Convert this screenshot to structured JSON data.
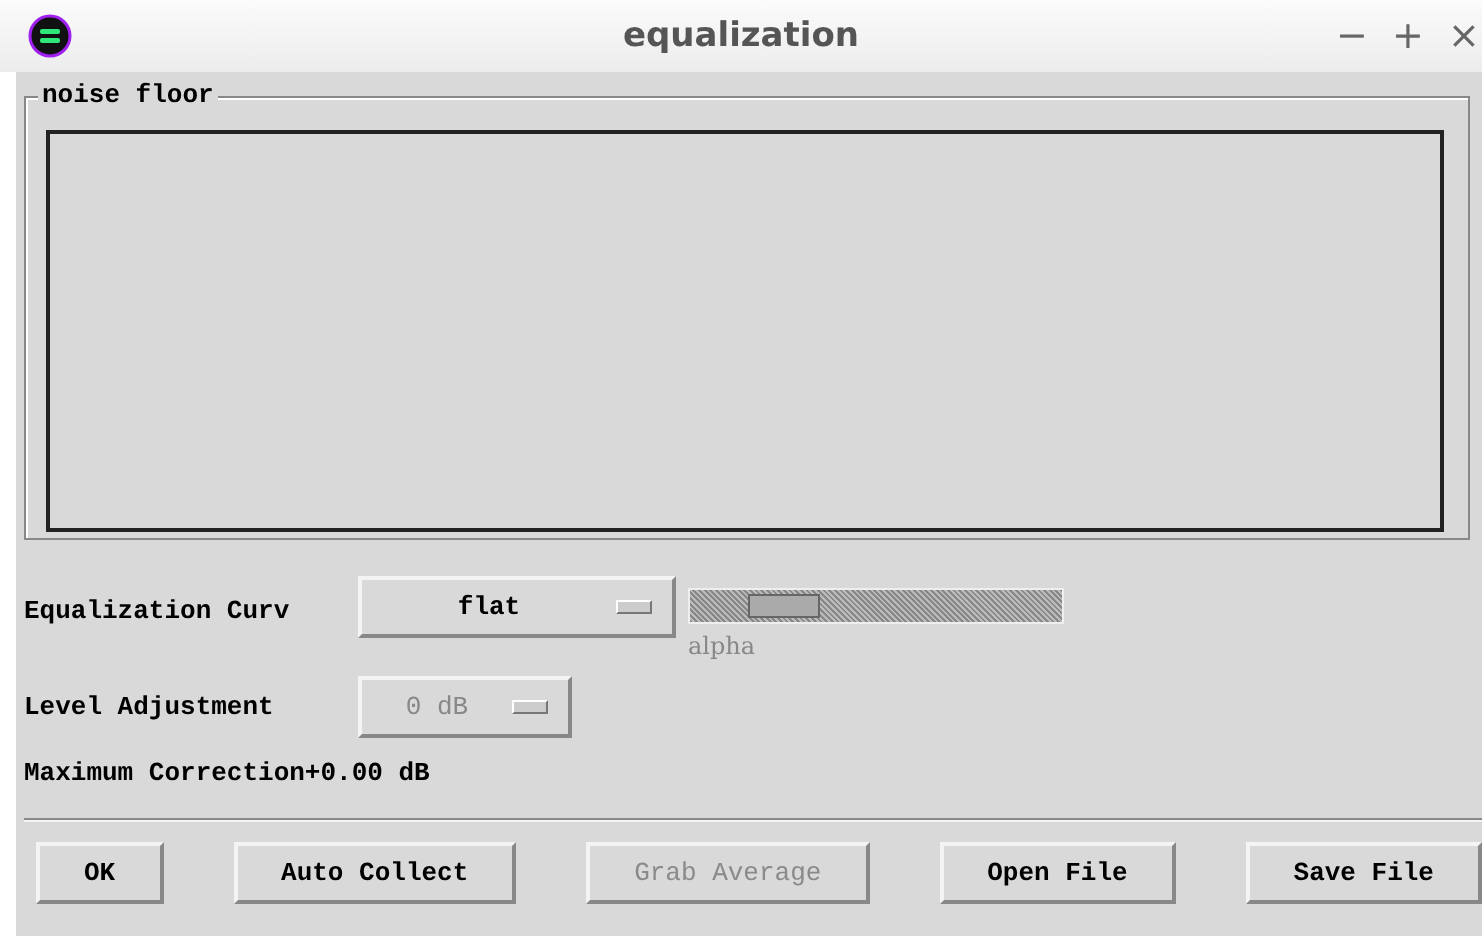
{
  "window": {
    "title": "equalization",
    "controls": [
      "−",
      "+",
      "×"
    ]
  },
  "noise_floor": {
    "title": "noise floor"
  },
  "equalization_curve": {
    "label": "Equalization Curv",
    "value": "flat",
    "disabled": false
  },
  "slider": {
    "label": "alpha",
    "level": 0.15,
    "disabled": true
  },
  "level_adjustment": {
    "label": "Level Adjustment",
    "value": "0 dB",
    "disabled": true
  },
  "maximum_correction": {
    "label": "Maximum Correction",
    "value": "+0.00 dB"
  },
  "buttons": [
    {
      "label": "OK",
      "disabled": false
    },
    {
      "label": "Auto Collect",
      "disabled": false
    },
    {
      "label": "Grab Average",
      "disabled": true
    },
    {
      "label": "Open File",
      "disabled": false
    },
    {
      "label": "Save File",
      "disabled": false
    }
  ]
}
